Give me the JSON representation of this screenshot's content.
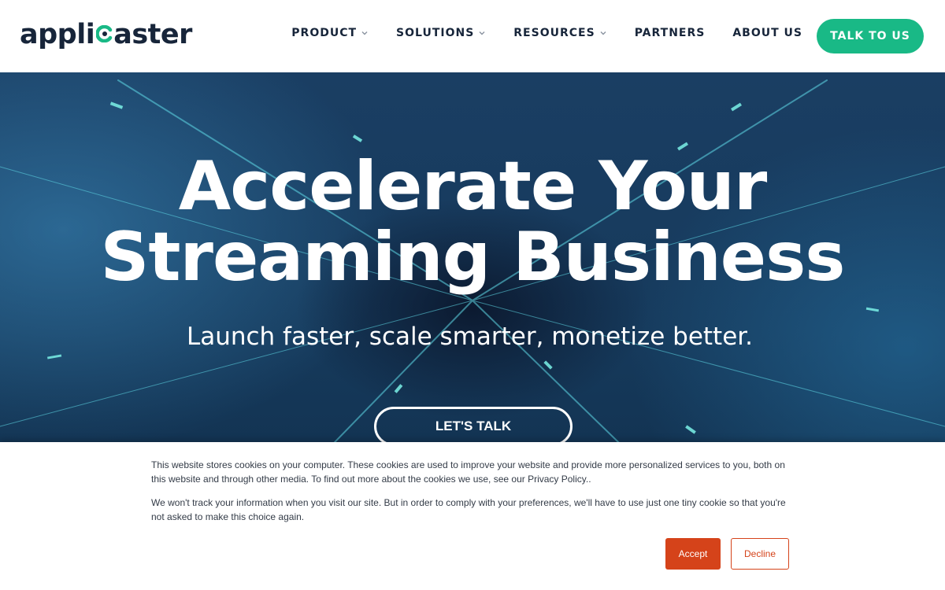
{
  "brand": {
    "logo_left": "appli",
    "logo_right": "aster",
    "accent": "#19b986",
    "dark": "#17253a"
  },
  "nav": {
    "items": [
      {
        "label": "PRODUCT",
        "dropdown": true
      },
      {
        "label": "SOLUTIONS",
        "dropdown": true
      },
      {
        "label": "RESOURCES",
        "dropdown": true
      },
      {
        "label": "PARTNERS",
        "dropdown": false
      },
      {
        "label": "ABOUT US",
        "dropdown": false
      }
    ],
    "cta_label": "TALK TO US"
  },
  "hero": {
    "title_line1": "Accelerate Your",
    "title_line2": "Streaming Business",
    "subtitle": "Launch faster, scale smarter, monetize better.",
    "cta_label": "LET'S TALK"
  },
  "cookie": {
    "paragraph1": "This website stores cookies on your computer. These cookies are used to improve your website and provide more personalized services to you, both on this website and through other media. To find out more about the cookies we use, see our Privacy Policy..",
    "paragraph2": "We won't track your information when you visit our site. But in order to comply with your preferences, we'll have to use just one tiny cookie so that you're not asked to make this choice again.",
    "accept_label": "Accept",
    "decline_label": "Decline",
    "accept_color": "#d5431a"
  }
}
